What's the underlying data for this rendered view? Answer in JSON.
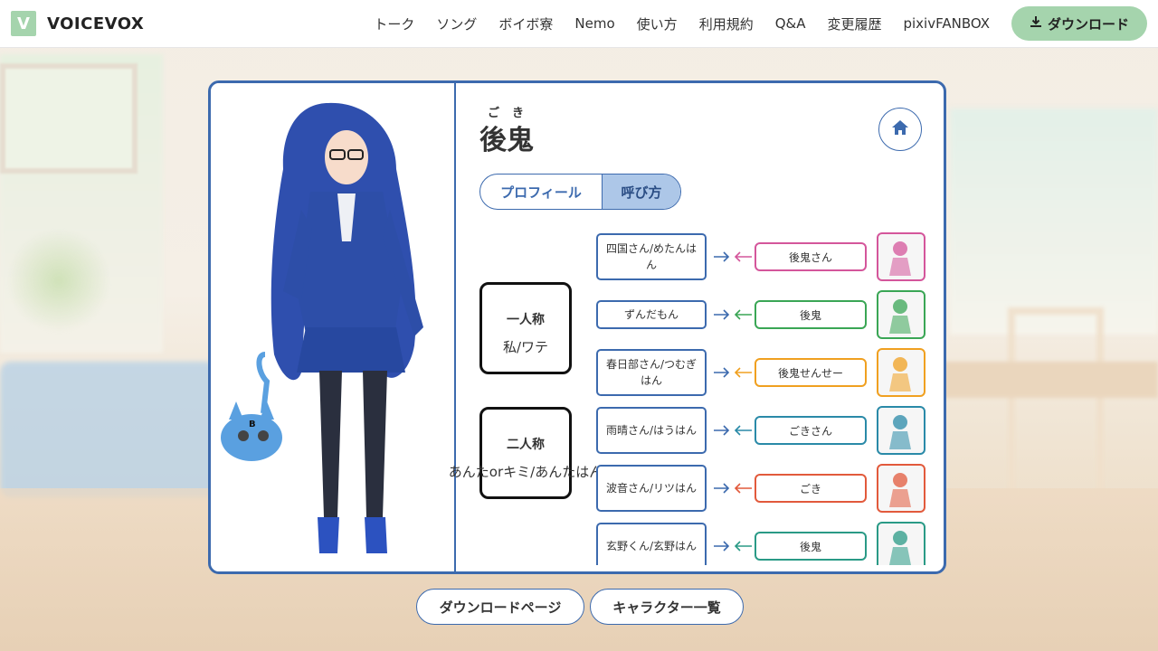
{
  "header": {
    "logo_mark": "V",
    "logo_text": "VOICEVOX",
    "nav": [
      "トーク",
      "ソング",
      "ボイボ寮",
      "Nemo",
      "使い方",
      "利用規約",
      "Q&A",
      "変更履歴",
      "pixivFANBOX"
    ],
    "download_label": "ダウンロード"
  },
  "character": {
    "ruby": "ごき",
    "name": "後鬼",
    "tabs": [
      "プロフィール",
      "呼び方"
    ],
    "active_tab": "呼び方"
  },
  "pronouns": {
    "first_title": "一人称",
    "first_value": "私/ワテ",
    "second_title": "二人称",
    "second_value": "あんたorキミ/あんたはん"
  },
  "calls": [
    {
      "target": "四国さん/めたんはん",
      "called_by": "後鬼さん",
      "color": "#d4569b"
    },
    {
      "target": "ずんだもん",
      "called_by": "後鬼",
      "color": "#3aa655"
    },
    {
      "target": "春日部さん/つむぎはん",
      "called_by": "後鬼せんせー",
      "color": "#f0a020"
    },
    {
      "target": "雨晴さん/はうはん",
      "called_by": "ごきさん",
      "color": "#2a8aa8"
    },
    {
      "target": "波音さん/リツはん",
      "called_by": "ごき",
      "color": "#e25a3c"
    },
    {
      "target": "玄野くん/玄野はん",
      "called_by": "後鬼",
      "color": "#2a9a86"
    }
  ],
  "footer_buttons": [
    "ダウンロードページ",
    "キャラクター一覧"
  ],
  "colors": {
    "accent": "#3c6aae",
    "brand_green": "#a5d4ad",
    "tab_active": "#adc7e8"
  }
}
